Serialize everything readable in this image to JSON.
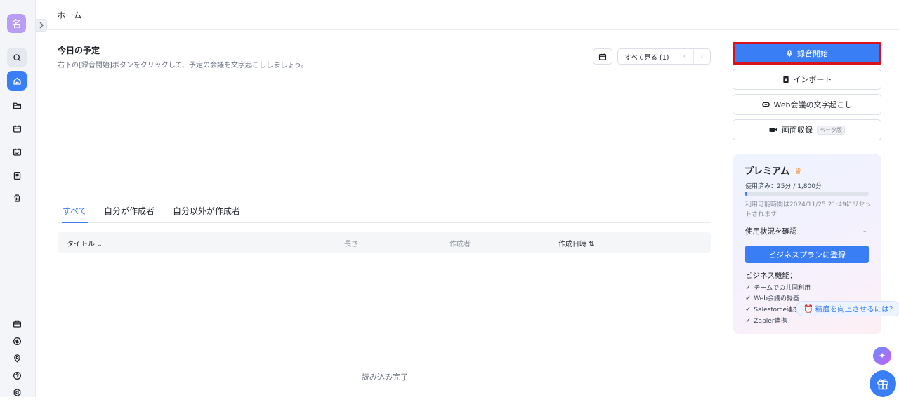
{
  "sidebar": {
    "avatar_text": "名",
    "top_icons": [
      "search-icon",
      "home-icon",
      "folder-icon",
      "calendar-icon",
      "calendar-check-icon",
      "document-icon",
      "trash-icon"
    ],
    "bottom_icons": [
      "briefcase-icon",
      "dollar-icon",
      "location-icon",
      "help-icon",
      "settings-icon"
    ],
    "active_item": "home-icon"
  },
  "header": {
    "title": "ホーム"
  },
  "schedule": {
    "title": "今日の予定",
    "subtitle": "右下の[録音開始]ボタンをクリックして、予定の会議を文字起こししましょう。",
    "see_all_label": "すべて見る (1)",
    "prev": "‹",
    "next": "›"
  },
  "tabs": [
    "すべて",
    "自分が作成者",
    "自分以外が作成者"
  ],
  "table": {
    "headers": {
      "title": "タイトル",
      "length": "長さ",
      "creator": "作成者",
      "created": "作成日時"
    }
  },
  "loaded_text": "読み込み完了",
  "actions": {
    "record": "録音開始",
    "import": "インポート",
    "web_meeting": "Web会議の文字起こし",
    "screen_record": "画面収録",
    "beta": "ベータ版"
  },
  "premium": {
    "title": "プレミアム",
    "used": "使用済み：25分 / 1,800分",
    "used_fraction": 0.014,
    "reset": "利用可能時間は2024/11/25 21:49にリセットされます",
    "usage_link": "使用状況を確認",
    "business_button": "ビジネスプランに登録",
    "features_title": "ビジネス機能：",
    "features": [
      "チームでの共同利用",
      "Web会議の録画",
      "Salesforce連携",
      "Zapier連携"
    ]
  },
  "accuracy_tip": "精度を向上させるには？",
  "colors": {
    "accent": "#3a7ef6",
    "highlight_border": "#d9121d",
    "avatar": "#b99cf3"
  }
}
